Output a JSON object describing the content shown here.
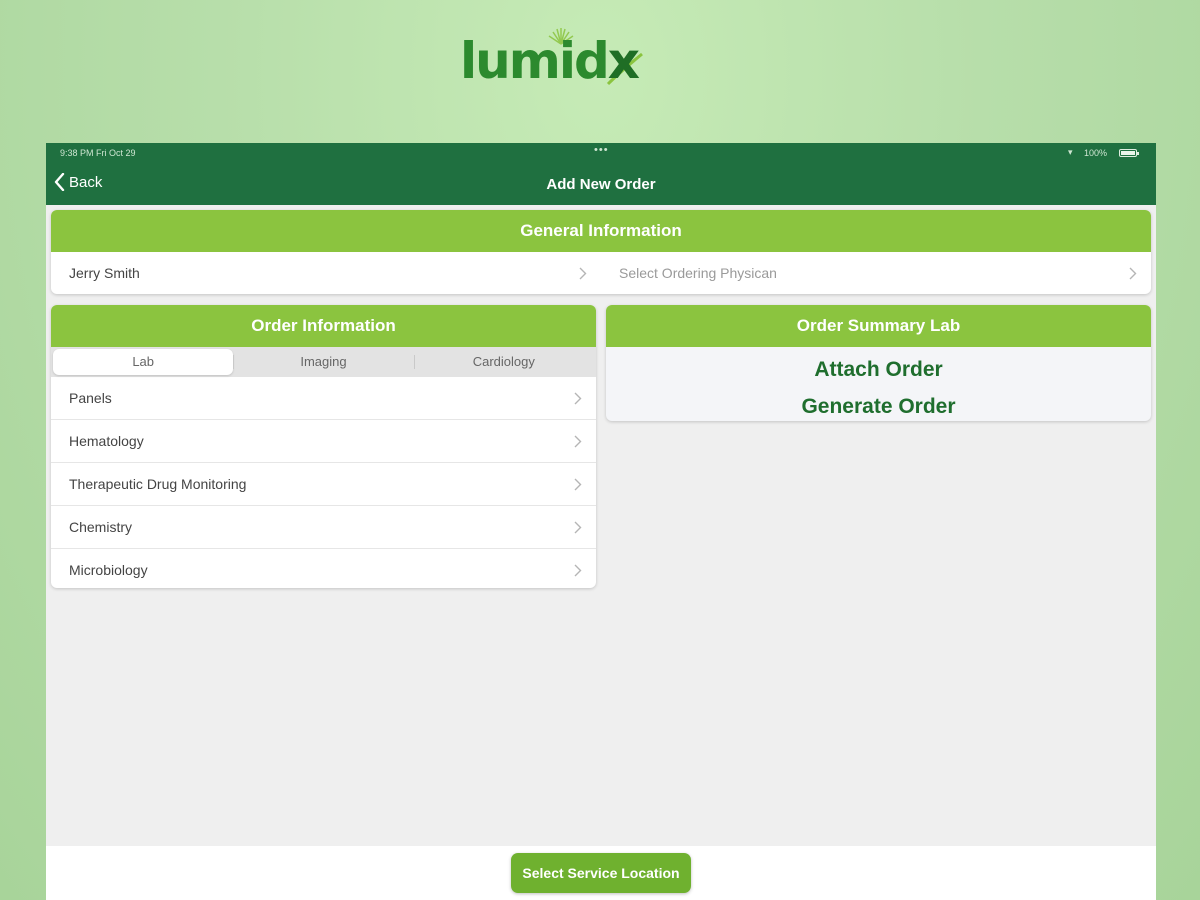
{
  "brand": {
    "logo_text_main": "lumid",
    "logo_text_accent": "x",
    "color_primary": "#2c8a2e",
    "color_dark": "#1f7040",
    "color_accent": "#8bc43f"
  },
  "status_bar": {
    "time": "9:38 PM   Fri Oct 29",
    "dots": "•••",
    "battery": "100%"
  },
  "nav": {
    "back_label": "Back",
    "title": "Add New Order",
    "back_icon": "chevron-left-icon"
  },
  "general": {
    "header": "General Information",
    "patient": "Jerry Smith",
    "physician_placeholder": "Select Ordering Physican"
  },
  "order_info": {
    "header": "Order Information",
    "tabs": [
      {
        "label": "Lab",
        "active": true
      },
      {
        "label": "Imaging",
        "active": false
      },
      {
        "label": "Cardiology",
        "active": false
      }
    ],
    "items": [
      {
        "label": "Panels"
      },
      {
        "label": "Hematology"
      },
      {
        "label": "Therapeutic Drug Monitoring"
      },
      {
        "label": "Chemistry"
      },
      {
        "label": "Microbiology"
      }
    ]
  },
  "summary": {
    "header": "Order Summary Lab",
    "attach_label": "Attach Order",
    "generate_label": "Generate Order"
  },
  "footer": {
    "service_location_label": "Select Service Location"
  }
}
